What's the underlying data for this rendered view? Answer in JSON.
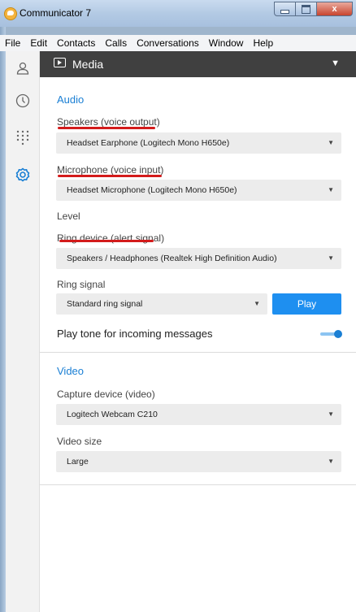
{
  "window": {
    "title": "Communicator 7",
    "controls": {
      "minimize": "",
      "maximize": "",
      "close": "x"
    }
  },
  "menubar": [
    "File",
    "Edit",
    "Contacts",
    "Calls",
    "Conversations",
    "Window",
    "Help"
  ],
  "rail": {
    "icons": [
      "contact-icon",
      "history-icon",
      "dialpad-icon",
      "settings-gear-icon"
    ],
    "active": "settings-gear-icon",
    "accent": "#1a7fd4"
  },
  "section": {
    "title": "Media",
    "icon": "media-play-icon",
    "collapse_glyph": "▼"
  },
  "audio": {
    "heading": "Audio",
    "speakers": {
      "label": "Speakers (voice output)",
      "value": "Headset Earphone (Logitech Mono H650e)"
    },
    "microphone": {
      "label": "Microphone (voice input)",
      "value": "Headset Microphone (Logitech Mono H650e)"
    },
    "level_label": "Level",
    "ring_device": {
      "label": "Ring device (alert signal)",
      "value": "Speakers / Headphones (Realtek High Definition Audio)"
    },
    "ring_signal": {
      "label": "Ring signal",
      "value": "Standard ring signal",
      "play_button": "Play"
    },
    "incoming_tone": {
      "label": "Play tone for incoming messages",
      "enabled": true
    }
  },
  "video": {
    "heading": "Video",
    "capture": {
      "label": "Capture device (video)",
      "value": "Logitech Webcam C210"
    },
    "size": {
      "label": "Video size",
      "value": "Large"
    }
  },
  "dropdown_glyph": "▼",
  "colors": {
    "accent": "#1a7fd4",
    "header_bg": "#404040",
    "play_button": "#1e8ff0",
    "annotation_underline": "#d31b1b"
  }
}
